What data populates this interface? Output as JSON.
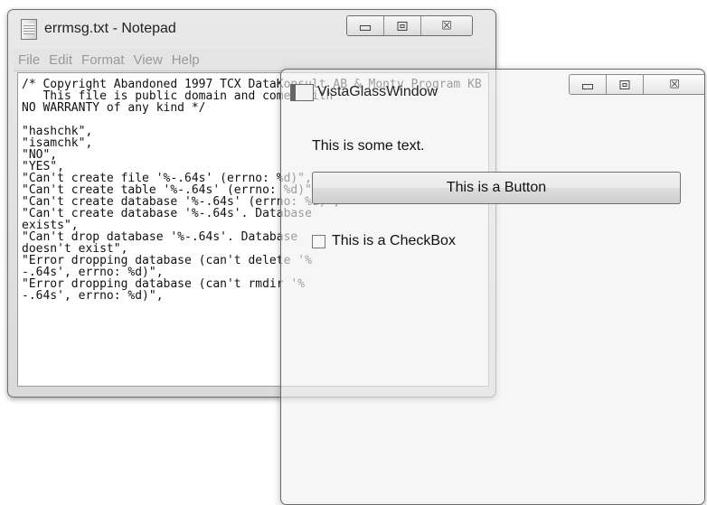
{
  "notepad": {
    "title": "errmsg.txt - Notepad",
    "menu": [
      "File",
      "Edit",
      "Format",
      "View",
      "Help"
    ],
    "content": "/* Copyright Abandoned 1997 TCX DataKonsult AB & Monty Program KB & Detron HB\n   This file is public domain and comes with\nNO WARRANTY of any kind */\n\n\"hashchk\",\n\"isamchk\",\n\"NO\",\n\"YES\",\n\"Can't create file '%-.64s' (errno: %d)\",\n\"Can't create table '%-.64s' (errno: %d)\",\n\"Can't create database '%-.64s' (errno: %d)\",\n\"Can't create database '%-.64s'. Database\nexists\",\n\"Can't drop database '%-.64s'. Database\ndoesn't exist\",\n\"Error dropping database (can't delete '%\n-.64s', errno: %d)\",\n\"Error dropping database (can't rmdir '%\n-.64s', errno: %d)\","
  },
  "glass_window": {
    "title": "VistaGlassWindow",
    "text": "This is some text.",
    "button_label": "This is a Button",
    "checkbox_label": "This is a CheckBox",
    "checkbox_checked": false
  },
  "caption_icons": {
    "minimize": "minimize-icon",
    "maximize": "maximize-icon",
    "close": "close-icon",
    "close_glyph": "☒"
  }
}
